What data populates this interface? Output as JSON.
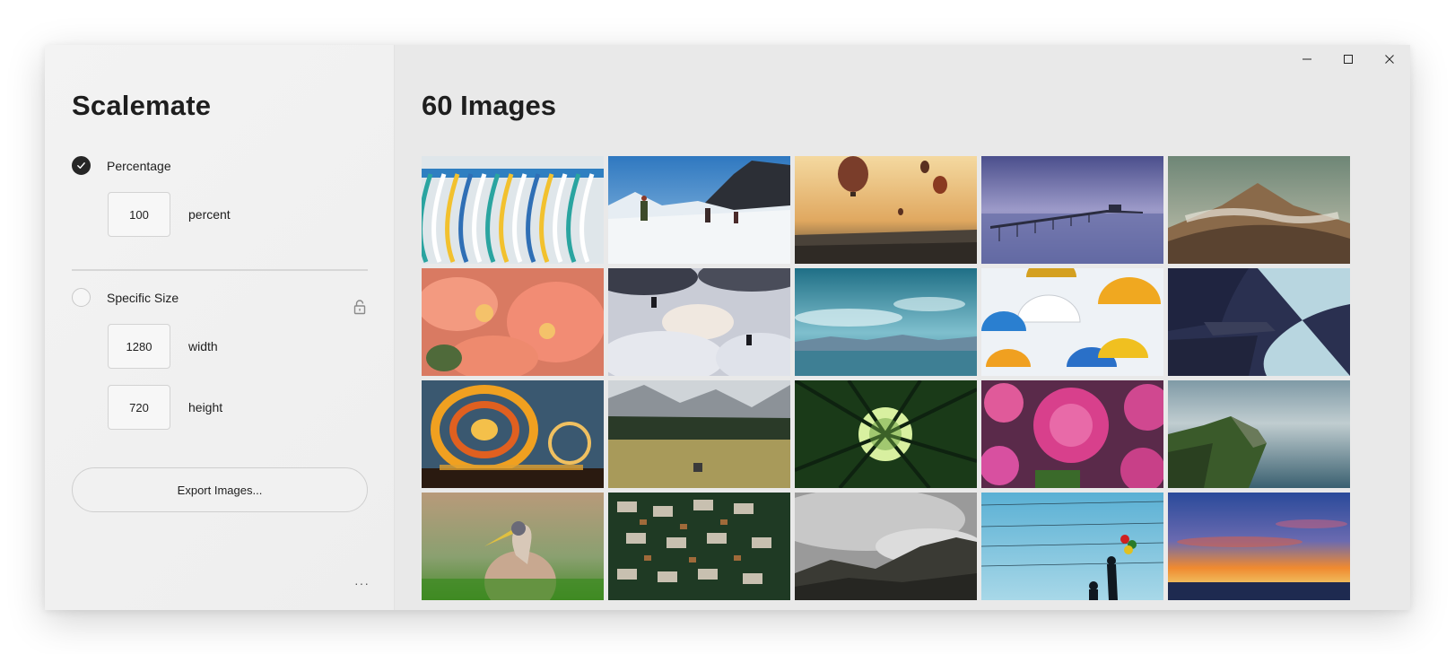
{
  "sidebar": {
    "app_title": "Scalemate",
    "percentage": {
      "label": "Percentage",
      "selected": true,
      "value": "100",
      "unit": "percent"
    },
    "specific_size": {
      "label": "Specific Size",
      "selected": false,
      "width": {
        "value": "1280",
        "unit": "width"
      },
      "height": {
        "value": "720",
        "unit": "height"
      },
      "lock_icon": "lock-icon"
    },
    "export_label": "Export Images...",
    "more_label": "···"
  },
  "window_controls": {
    "minimize": "minimize-icon",
    "maximize": "maximize-icon",
    "close": "close-icon"
  },
  "main": {
    "title": "60 Images",
    "images": [
      "coat-hangers",
      "snow-hikers",
      "hot-air-balloons",
      "pier-at-dusk",
      "volcano-landscape",
      "pink-flowers",
      "clouds-silhouettes",
      "sea-and-sky",
      "umbrellas",
      "fjord-cliff",
      "carnival-ride",
      "valley-meadow",
      "bamboo-forest",
      "dahlias",
      "coastal-cliffs",
      "heron-bird",
      "circuit-board",
      "misty-mountains",
      "balloon-silhouette",
      "sunset-sea"
    ]
  },
  "colors": {
    "accent": "#262626",
    "sidebar_bg": "#f0f0f0",
    "main_bg": "#e9e9e9"
  }
}
